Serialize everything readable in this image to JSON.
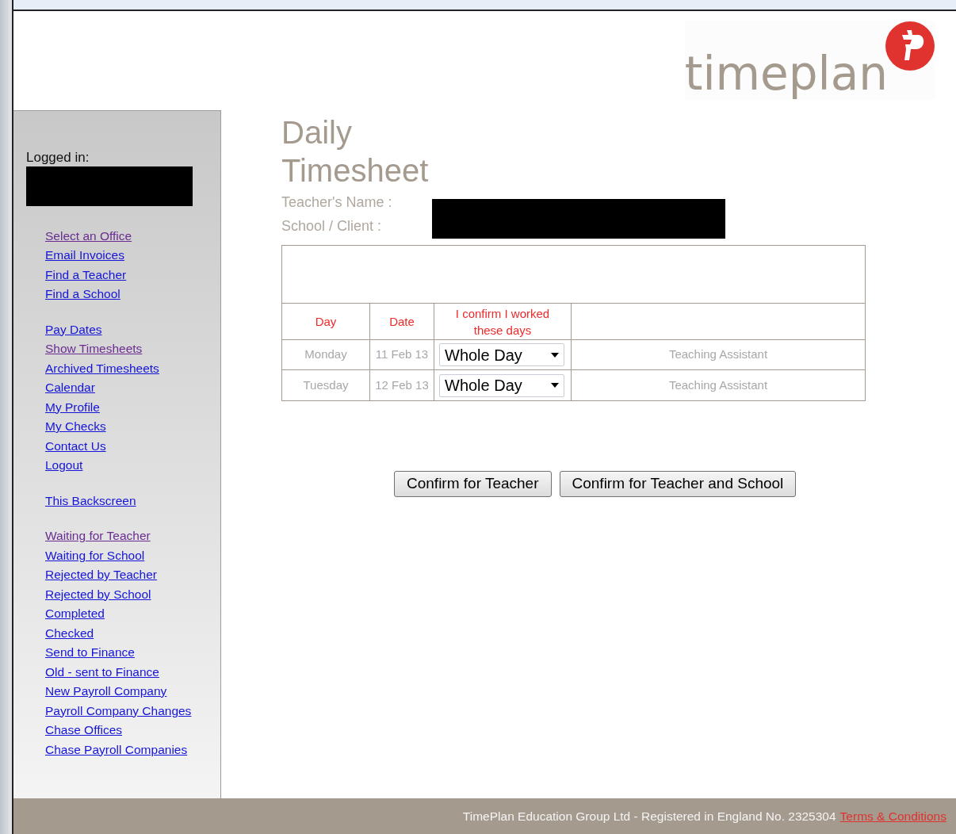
{
  "logo": {
    "text": "timeplan"
  },
  "sidebar": {
    "logged_in_label": "Logged in:",
    "link_groups": [
      [
        {
          "label": "Select an Office",
          "visited": true
        },
        {
          "label": "Email Invoices",
          "visited": false
        },
        {
          "label": "Find a Teacher",
          "visited": false
        },
        {
          "label": "Find a School",
          "visited": false
        }
      ],
      [
        {
          "label": "Pay Dates",
          "visited": false
        },
        {
          "label": "Show Timesheets",
          "visited": true
        },
        {
          "label": "Archived Timesheets",
          "visited": false
        },
        {
          "label": "Calendar",
          "visited": false
        },
        {
          "label": "My Profile",
          "visited": false
        },
        {
          "label": "My Checks",
          "visited": false
        },
        {
          "label": "Contact Us",
          "visited": false
        },
        {
          "label": "Logout",
          "visited": false
        }
      ],
      [
        {
          "label": "This Backscreen",
          "visited": false
        }
      ],
      [
        {
          "label": "Waiting for Teacher",
          "visited": true
        },
        {
          "label": "Waiting for School",
          "visited": false
        },
        {
          "label": "Rejected by Teacher",
          "visited": false
        },
        {
          "label": "Rejected by School",
          "visited": false
        },
        {
          "label": "Completed",
          "visited": false
        },
        {
          "label": "Checked",
          "visited": false
        },
        {
          "label": "Send to Finance",
          "visited": false
        },
        {
          "label": "Old - sent to Finance",
          "visited": false
        },
        {
          "label": "New Payroll Company",
          "visited": false
        },
        {
          "label": "Payroll Company Changes",
          "visited": false
        },
        {
          "label": "Chase Offices",
          "visited": false
        },
        {
          "label": "Chase Payroll Companies",
          "visited": false
        }
      ]
    ]
  },
  "title": [
    "Daily",
    "Timesheet"
  ],
  "fields": [
    {
      "label": "Teacher's Name :"
    },
    {
      "label": "School / Client :"
    }
  ],
  "table": {
    "columns": [
      "Day",
      "Date",
      "I confirm I worked these days"
    ],
    "rows": [
      {
        "day": "Monday",
        "date": "11 Feb 13",
        "value": "Whole Day",
        "role": "Teaching Assistant"
      },
      {
        "day": "Tuesday",
        "date": "12 Feb 13",
        "value": "Whole Day",
        "role": "Teaching Assistant"
      }
    ]
  },
  "buttons": [
    "Confirm for Teacher",
    "Confirm for Teacher and School"
  ],
  "footer": {
    "text": "TimePlan Education Group Ltd - Registered in England No. 2325304",
    "link": "Terms & Conditions"
  }
}
